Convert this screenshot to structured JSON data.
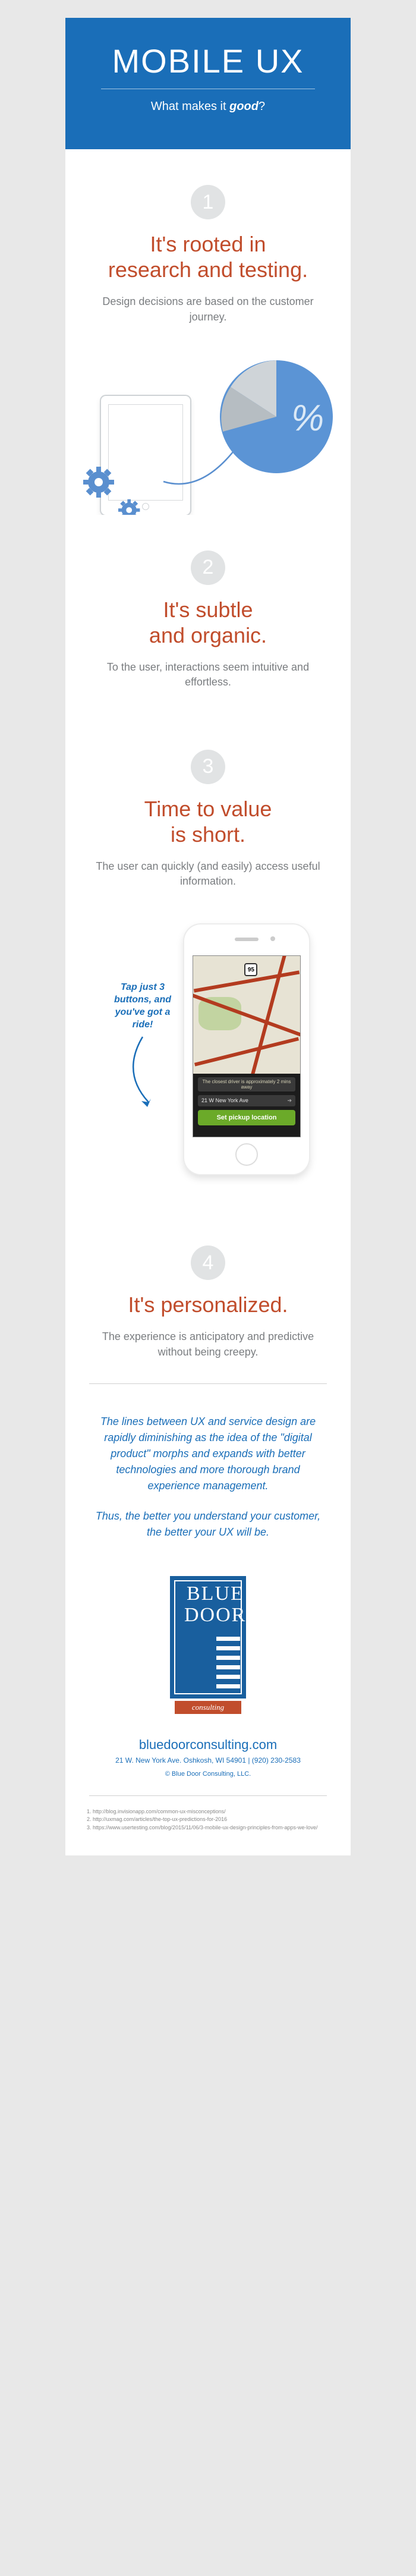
{
  "hero": {
    "title": "MOBILE UX",
    "sub_pre": "What makes it ",
    "sub_em": "good",
    "sub_post": "?"
  },
  "sections": [
    {
      "num": "1",
      "title": "It's rooted in\nresearch and testing.",
      "desc": "Design decisions are based on the customer journey."
    },
    {
      "num": "2",
      "title": "It's subtle\nand organic.",
      "desc": "To the user, interactions seem intuitive and effortless."
    },
    {
      "num": "3",
      "title": "Time to value\nis short.",
      "desc": "The user can quickly (and easily) access useful information."
    },
    {
      "num": "4",
      "title": "It's personalized.",
      "desc": "The experience is anticipatory and predictive without being creepy."
    }
  ],
  "pie": {
    "percent_glyph": "%"
  },
  "illus3": {
    "callout": "Tap just 3 buttons, and you've got a ride!",
    "route_shield": "95",
    "status": "The closest driver is approximately 2 mins away",
    "address": "21 W New York Ave",
    "button": "Set pickup location"
  },
  "conclusion": {
    "p1": "The lines between UX and service design are rapidly diminishing as the idea of the \"digital product\" morphs and expands with better technologies and more thorough brand experience management.",
    "p2": "Thus, the better you understand your customer, the better your UX will be."
  },
  "logo": {
    "word1": "BLUE",
    "word2": "DOOR",
    "tag": "consulting"
  },
  "footer": {
    "url": "bluedoorconsulting.com",
    "address": "21 W. New York Ave. Oshkosh, WI 54901  |  (920) 230-2583",
    "copyright": "© Blue Door Consulting, LLC."
  },
  "references": [
    "http://blog.invisionapp.com/common-ux-misconceptions/",
    "http://uxmag.com/articles/the-top-ux-predictions-for-2016",
    "https://www.usertesting.com/blog/2015/11/06/3-mobile-ux-design-principles-from-apps-we-love/"
  ]
}
